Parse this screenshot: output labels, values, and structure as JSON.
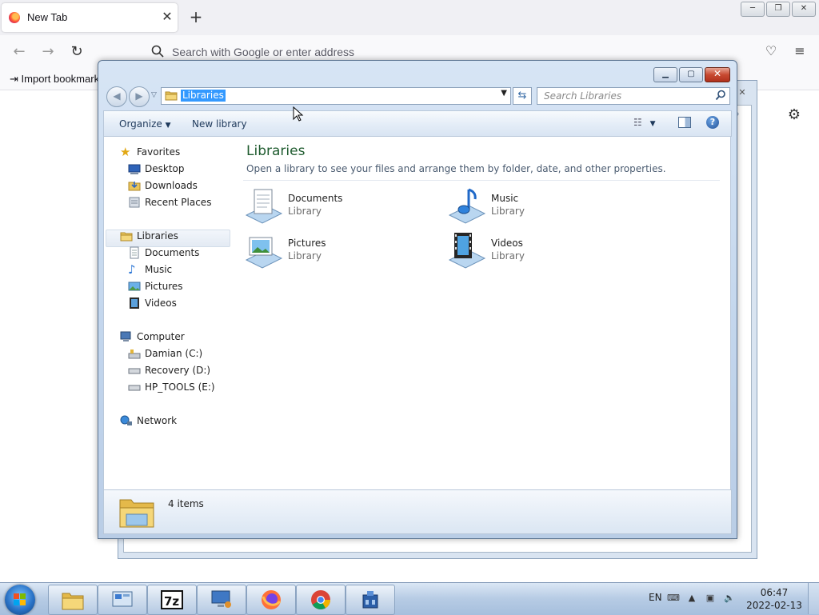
{
  "browser": {
    "tab_title": "New Tab",
    "tab_close": "✕",
    "new_tab": "+",
    "url_placeholder": "Search with Google or enter address",
    "bookmark_item": "Import bookmarks...",
    "win_minimize": "─",
    "win_restore": "❐",
    "win_close": "✕"
  },
  "explorer": {
    "address_value": "Libraries",
    "search_placeholder": "Search Libraries",
    "toolbar": {
      "organize": "Organize",
      "new_library": "New library"
    },
    "nav": {
      "favorites": "Favorites",
      "favorites_items": [
        "Desktop",
        "Downloads",
        "Recent Places"
      ],
      "libraries": "Libraries",
      "libraries_items": [
        "Documents",
        "Music",
        "Pictures",
        "Videos"
      ],
      "computer": "Computer",
      "computer_items": [
        "Damian (C:)",
        "Recovery (D:)",
        "HP_TOOLS (E:)"
      ],
      "network": "Network"
    },
    "content": {
      "title": "Libraries",
      "subtitle": "Open a library to see your files and arrange them by folder, date, and other properties.",
      "libraries": [
        {
          "name": "Documents",
          "type": "Library"
        },
        {
          "name": "Music",
          "type": "Library"
        },
        {
          "name": "Pictures",
          "type": "Library"
        },
        {
          "name": "Videos",
          "type": "Library"
        }
      ]
    },
    "details": {
      "count": "4 items"
    }
  },
  "taskbar": {
    "language": "EN",
    "time": "06:47",
    "date": "2022-02-13",
    "pinned": [
      "explorer-icon",
      "control-panel-icon",
      "7zip-icon",
      "remote-desktop-icon",
      "firefox-icon",
      "chrome-icon",
      "network-tool-icon"
    ]
  },
  "colors": {
    "selection": "#3399ff",
    "title_green": "#1e5b2e",
    "chrome_blue": "#c2d5ec"
  }
}
